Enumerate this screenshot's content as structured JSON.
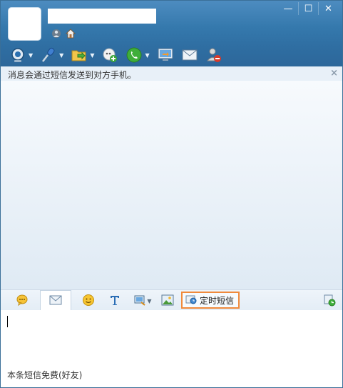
{
  "window": {
    "controls": {
      "minimize": "—",
      "maximize": "☐",
      "close": "✕"
    }
  },
  "toolbar": {
    "items": [
      {
        "icon": "video-call-icon",
        "has_dropdown": true
      },
      {
        "icon": "voice-call-icon",
        "has_dropdown": true
      },
      {
        "icon": "file-transfer-icon",
        "has_dropdown": true
      },
      {
        "icon": "group-chat-icon",
        "has_dropdown": false
      },
      {
        "icon": "phone-call-icon",
        "has_dropdown": true
      },
      {
        "icon": "remote-assist-icon",
        "has_dropdown": false
      },
      {
        "icon": "mail-icon",
        "has_dropdown": false
      },
      {
        "icon": "block-user-icon",
        "has_dropdown": false
      }
    ]
  },
  "notice": {
    "text": "消息会通过短信发送到对方手机。",
    "close": "×"
  },
  "input_toolbar": {
    "timed_sms_label": "定时短信"
  },
  "footer": {
    "text": "本条短信免费(好友)"
  },
  "colors": {
    "header_blue": "#3579ad",
    "highlight_orange": "#f08a3c"
  }
}
